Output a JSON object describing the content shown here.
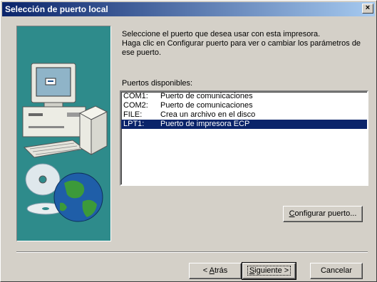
{
  "window": {
    "title": "Selección de puerto local",
    "close_label": "×"
  },
  "intro": {
    "line1": "Seleccione el puerto que desea usar con esta impresora.",
    "line2": "Haga clic en Configurar puerto para ver o cambiar los parámetros de ese puerto."
  },
  "ports": {
    "label": "Puertos disponibles:",
    "items": [
      {
        "port": "COM1:",
        "description": "Puerto de comunicaciones",
        "selected": false
      },
      {
        "port": "COM2:",
        "description": "Puerto de comunicaciones",
        "selected": false
      },
      {
        "port": "FILE:",
        "description": "Crea un archivo en el disco",
        "selected": false
      },
      {
        "port": "LPT1:",
        "description": "Puerto de impresora ECP",
        "selected": true
      }
    ]
  },
  "buttons": {
    "configure_u": "C",
    "configure_rest": "onfigurar puerto...",
    "back_prefix": "< ",
    "back_u": "A",
    "back_rest": "trás",
    "next_u": "S",
    "next_rest": "iguiente >",
    "cancel": "Cancelar"
  },
  "colors": {
    "title_start": "#0a246a",
    "title_end": "#a6caf0",
    "selection": "#0a246a",
    "illustration_bg": "#2e8b8b"
  },
  "icons": {
    "illustration": "computer-printer-cd-globe"
  }
}
